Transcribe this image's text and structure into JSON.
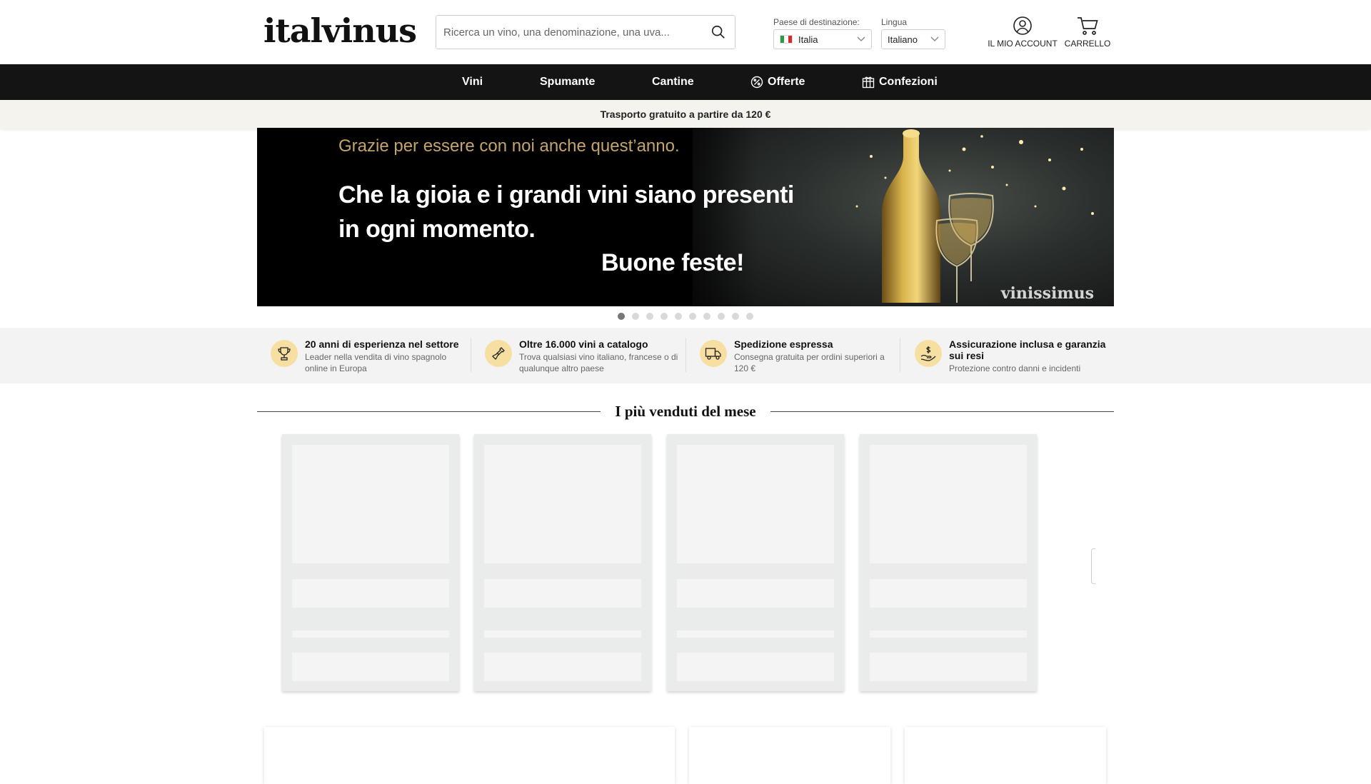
{
  "header": {
    "logo": "italvinus",
    "search_placeholder": "Ricerca un vino, una denominazione, una uva...",
    "country_label": "Paese di destinazione:",
    "country_value": "Italia",
    "language_label": "Lingua",
    "language_value": "Italiano",
    "account_label": "IL MIO ACCOUNT",
    "cart_label": "CARRELLO",
    "icons": [
      "search-icon",
      "italy-flag-icon",
      "chevron-down-icon",
      "user-icon",
      "cart-icon"
    ]
  },
  "nav": {
    "items": [
      {
        "label": "Vini"
      },
      {
        "label": "Spumante"
      },
      {
        "label": "Cantine"
      },
      {
        "label": "Offerte",
        "icon": "discount-icon"
      },
      {
        "label": "Confezioni",
        "icon": "gift-box-icon"
      }
    ]
  },
  "shipping_bar": "Trasporto gratuito a partire da 120 €",
  "banner": {
    "subtitle": "Grazie per essere con noi anche quest’anno.",
    "line1": "Che la gioia e i grandi vini siano presenti",
    "line2": "in ogni momento.",
    "greeting": "Buone feste!",
    "brand": "vinissimus",
    "slides_count": 10,
    "active_slide": 1
  },
  "features": [
    {
      "title": "20 anni di esperienza nel settore",
      "desc": "Leader nella vendita di vino spagnolo online in Europa",
      "icon": "trophy-icon"
    },
    {
      "title": "Oltre 16.000 vini a catalogo",
      "desc": "Trova qualsiasi vino italiano, francese o di qualunque altro paese",
      "icon": "bottle-icon"
    },
    {
      "title": "Spedizione espressa",
      "desc": "Consegna gratuita per ordini superiori a 120 €",
      "icon": "truck-icon"
    },
    {
      "title": "Assicurazione inclusa e garanzia sui resi",
      "desc": "Protezione contro danni e incidenti",
      "icon": "money-hand-icon"
    }
  ],
  "bestsellers": {
    "title": "I più venduti del mese"
  },
  "colors": {
    "nav_bg": "#141414",
    "accent_gold": "#c4a46a",
    "feature_icon_bg": "#f6dfa0",
    "shipping_bg": "#f4f3ee"
  }
}
